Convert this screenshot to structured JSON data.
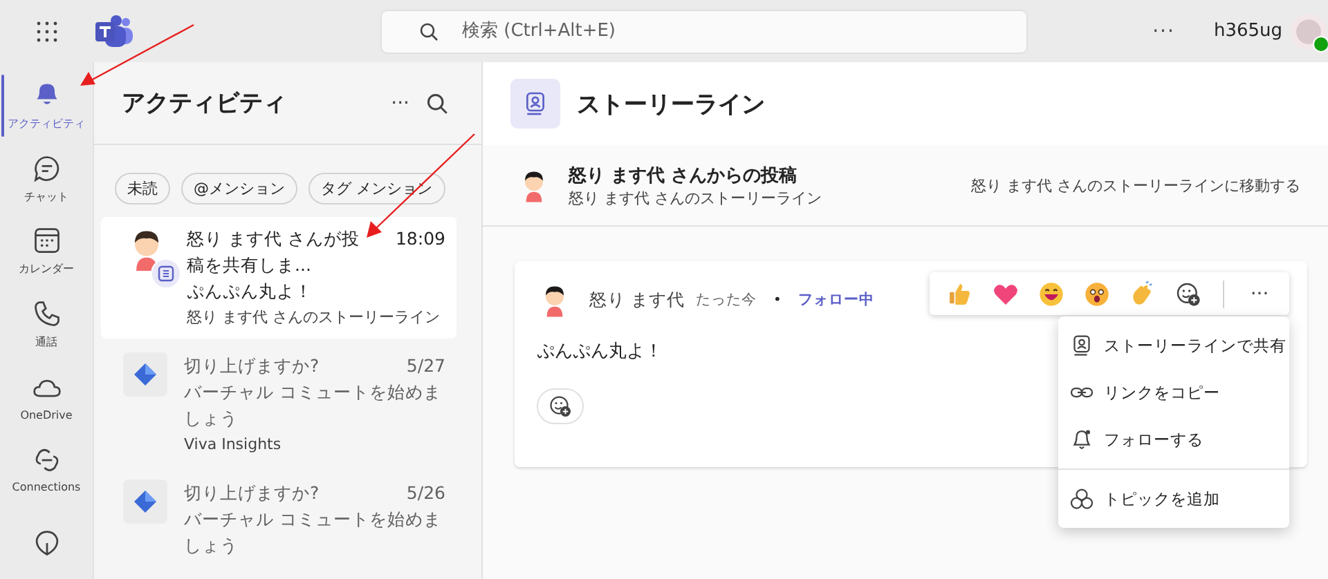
{
  "app_bar": {
    "search_placeholder": "検索 (Ctrl+Alt+E)",
    "more": "···",
    "user_name": "h365ug"
  },
  "rail": [
    {
      "kind": "bell",
      "label": "アクティビティ",
      "selected": true
    },
    {
      "kind": "chat",
      "label": "チャット",
      "selected": false
    },
    {
      "kind": "calendar",
      "label": "カレンダー",
      "selected": false
    },
    {
      "kind": "call",
      "label": "通話",
      "selected": false
    },
    {
      "kind": "cloud",
      "label": "OneDrive",
      "selected": false
    },
    {
      "kind": "connections",
      "label": "Connections",
      "selected": false
    },
    {
      "kind": "leaf",
      "selected": false
    }
  ],
  "activity": {
    "title": "アクティビティ",
    "more": "···",
    "filters": [
      "未読",
      "@メンション",
      "タグ メンション"
    ],
    "items": [
      {
        "kind": "person",
        "title": "怒り ます代 さんが投稿を共有しま...",
        "time": "18:09",
        "preview": "ぷんぷん丸よ！",
        "source": "怒り ます代 さんのストーリーライン",
        "selected": true
      },
      {
        "kind": "app",
        "title": "切り上げますか?",
        "time": "5/27",
        "preview": "バーチャル コミュートを始めましょう",
        "source": "Viva Insights",
        "selected": false
      },
      {
        "kind": "app",
        "title": "切り上げますか?",
        "time": "5/26",
        "preview": "バーチャル コミュートを始めましょう",
        "selected": false
      }
    ]
  },
  "storyline": {
    "title": "ストーリーライン",
    "banner": {
      "title": "怒り ます代 さんからの投稿",
      "subtitle": "怒り ます代 さんのストーリーライン",
      "link": "怒り ます代 さんのストーリーラインに移動する"
    },
    "post": {
      "author": "怒り ます代",
      "time": "たった今",
      "separator": "•",
      "follow": "フォロー中",
      "body": "ぷんぷん丸よ！"
    },
    "reactions": [
      {
        "kind": "like"
      },
      {
        "kind": "heart"
      },
      {
        "kind": "laugh"
      },
      {
        "kind": "surprised"
      },
      {
        "kind": "clap"
      }
    ],
    "reactions_more": "···",
    "menu": [
      {
        "kind": "share",
        "label": "ストーリーラインで共有"
      },
      {
        "kind": "link",
        "label": "リンクをコピー"
      },
      {
        "kind": "follow",
        "label": "フォローする"
      },
      {
        "kind": "topic",
        "label": "トピックを追加",
        "separated": true
      }
    ]
  }
}
